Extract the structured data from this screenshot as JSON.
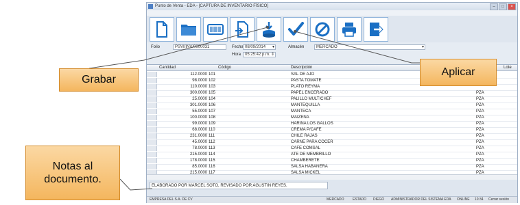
{
  "window": {
    "title": "Punto de Venta - EDA - [CAPTURA DE INVENTARIO FÍSICO]"
  },
  "toolbar": {
    "buttons": [
      {
        "name": "new-document-icon",
        "color": "#1a6fc4"
      },
      {
        "name": "folder-icon",
        "color": "#1a6fc4"
      },
      {
        "name": "barcode-icon",
        "color": "#1a6fc4"
      },
      {
        "name": "import-icon",
        "color": "#1a6fc4"
      },
      {
        "name": "save-icon",
        "color": "#1a6fc4"
      },
      {
        "name": "checkmark-icon",
        "color": "#1a6fc4"
      },
      {
        "name": "cancel-icon",
        "color": "#1a6fc4"
      },
      {
        "name": "printer-icon",
        "color": "#1a6fc4"
      },
      {
        "name": "exit-icon",
        "color": "#1a6fc4"
      }
    ]
  },
  "form": {
    "folio_label": "Folio",
    "folio_value": "PSVI/INV/0000031",
    "fecha_label": "Fecha",
    "fecha_value": "08/09/2014",
    "hora_label": "Hora",
    "hora_value": "05:25:42 p.m.",
    "almacen_label": "Almacén",
    "almacen_value": "MERCADO"
  },
  "grid": {
    "columns": [
      "Cantidad",
      "Código",
      "Descripción",
      "Lote"
    ],
    "rows": [
      {
        "cantidad": "112.0000",
        "codigo": "101",
        "descripcion": "SAL DE AJO",
        "unidad": ""
      },
      {
        "cantidad": "98.0000",
        "codigo": "102",
        "descripcion": "PASTA TOMATE",
        "unidad": ""
      },
      {
        "cantidad": "110.0000",
        "codigo": "103",
        "descripcion": "PLATO REYMA",
        "unidad": ""
      },
      {
        "cantidad": "300.0000",
        "codigo": "105",
        "descripcion": "PAPEL ENCERADO",
        "unidad": "PZA"
      },
      {
        "cantidad": "25.0000",
        "codigo": "104",
        "descripcion": "PALILLO MULTICHEF",
        "unidad": "PZA"
      },
      {
        "cantidad": "301.0000",
        "codigo": "106",
        "descripcion": "MANTEQUILLA",
        "unidad": "PZA"
      },
      {
        "cantidad": "55.0000",
        "codigo": "107",
        "descripcion": "MANTECA",
        "unidad": "PZA"
      },
      {
        "cantidad": "100.0000",
        "codigo": "108",
        "descripcion": "MAIZENA",
        "unidad": "PZA"
      },
      {
        "cantidad": "99.0000",
        "codigo": "109",
        "descripcion": "HARINA LOS GALLOS",
        "unidad": "PZA"
      },
      {
        "cantidad": "68.0000",
        "codigo": "110",
        "descripcion": "CREMA P/CAFE",
        "unidad": "PZA"
      },
      {
        "cantidad": "231.0000",
        "codigo": "111",
        "descripcion": "CHILE RAJAS",
        "unidad": "PZA"
      },
      {
        "cantidad": "45.0000",
        "codigo": "112",
        "descripcion": "CARNE PARA COCER",
        "unidad": "PZA"
      },
      {
        "cantidad": "78.0000",
        "codigo": "113",
        "descripcion": "CAFE COMSAL",
        "unidad": "PZA"
      },
      {
        "cantidad": "215.0000",
        "codigo": "114",
        "descripcion": "ATE DE MEMBRILLO",
        "unidad": "PZA"
      },
      {
        "cantidad": "178.0000",
        "codigo": "115",
        "descripcion": "CHAMBERETE",
        "unidad": "PZA"
      },
      {
        "cantidad": "85.0000",
        "codigo": "116",
        "descripcion": "SALSA HABANERA",
        "unidad": "PZA"
      },
      {
        "cantidad": "215.0000",
        "codigo": "117",
        "descripcion": "SALSA MICKEL",
        "unidad": "PZA"
      }
    ]
  },
  "notes": {
    "value": "ELABORADO POR MARCEL SOTO, REVISADO POR AGUSTIN REYES."
  },
  "statusbar": {
    "items": [
      "EMPRESA DEL S.A. DE CV",
      "MERCADO",
      "ESTADO",
      "DIEGO",
      "ADMINISTRADOR DEL SISTEMA EDA",
      "ONLINE",
      "10:34",
      "Cerrar sesión"
    ]
  },
  "callouts": {
    "grabar": "Grabar",
    "aplicar": "Aplicar",
    "notas": "Notas al documento."
  },
  "colors": {
    "accent": "#1a6fc4",
    "callout": "#f4b65e"
  }
}
